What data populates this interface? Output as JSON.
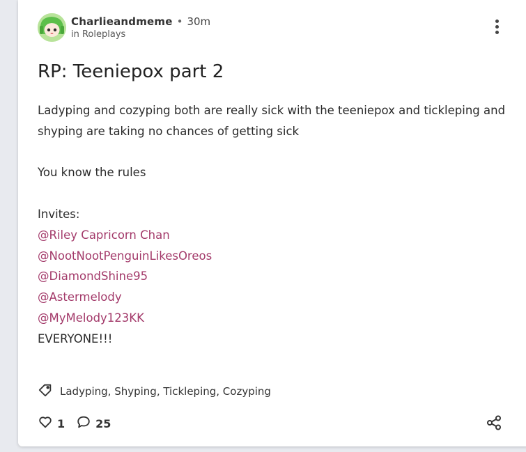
{
  "post": {
    "author": "Charlieandmeme",
    "separator": "•",
    "time": "30m",
    "category": "in Roleplays",
    "title": "RP: Teeniepox part 2",
    "paragraph1": "Ladyping and cozyping both are really sick with the teeniepox and tickleping and shyping are taking no chances of getting sick",
    "paragraph2": "You know the rules",
    "invites_label": "Invites:",
    "mentions": [
      "@Riley Capricorn Chan",
      "@NootNootPenguinLikesOreos",
      "@DiamondShine95",
      "@Astermelody",
      "@MyMelody123KK"
    ],
    "closing": "EVERYONE!!!",
    "tags": "Ladyping, Shyping, Tickleping, Cozyping",
    "likes": "1",
    "comments": "25"
  },
  "colors": {
    "mention": "#a33a6a",
    "background": "#e8eaef",
    "card": "#ffffff"
  },
  "icons": [
    "avatar-green-character",
    "more-vertical-icon",
    "tag-icon",
    "heart-icon",
    "comment-icon",
    "share-icon"
  ]
}
